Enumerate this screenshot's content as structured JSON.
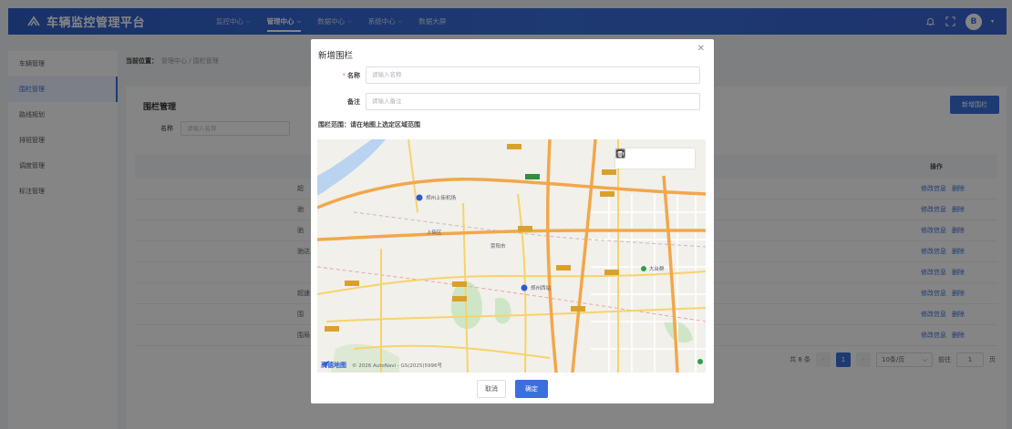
{
  "header": {
    "brand_title": "车辆监控管理平台",
    "nav": [
      {
        "label": "监控中心",
        "has_dropdown": true,
        "active": false
      },
      {
        "label": "管理中心",
        "has_dropdown": true,
        "active": true
      },
      {
        "label": "数据中心",
        "has_dropdown": true,
        "active": false
      },
      {
        "label": "系统中心",
        "has_dropdown": true,
        "active": false
      },
      {
        "label": "数据大屏",
        "has_dropdown": false,
        "active": false
      }
    ],
    "avatar_text": "B"
  },
  "sidebar": {
    "items": [
      {
        "label": "车辆管理",
        "active": false
      },
      {
        "label": "围栏管理",
        "active": true
      },
      {
        "label": "路线规划",
        "active": false
      },
      {
        "label": "排班管理",
        "active": false
      },
      {
        "label": "调度管理",
        "active": false
      },
      {
        "label": "标注管理",
        "active": false
      }
    ]
  },
  "breadcrumb": {
    "prefix": "当前位置：",
    "path": "管理中心 / 围栏管理"
  },
  "page": {
    "title": "围栏管理",
    "filter_label": "名称",
    "filter_placeholder": "请输入名称",
    "add_button": "新增围栏",
    "col_ops": "操作",
    "rows": [
      {
        "name": "超",
        "edit": "修改信息",
        "delete": "删除"
      },
      {
        "name": "驰",
        "edit": "修改信息",
        "delete": "删除"
      },
      {
        "name": "驰",
        "edit": "修改信息",
        "delete": "删除"
      },
      {
        "name": "驰达",
        "edit": "修改信息",
        "delete": "删除"
      },
      {
        "name": "",
        "edit": "修改信息",
        "delete": "删除"
      },
      {
        "name": "超速",
        "edit": "修改信息",
        "delete": "删除"
      },
      {
        "name": "围",
        "edit": "修改信息",
        "delete": "删除"
      },
      {
        "name": "围局",
        "edit": "修改信息",
        "delete": "删除"
      }
    ],
    "pagination": {
      "total": "共 8 条",
      "current": "1",
      "page_size": "10条/页",
      "goto_label": "前往",
      "goto_value": "1",
      "page_suffix": "页"
    }
  },
  "dialog": {
    "title": "新增围栏",
    "name_label": "名称",
    "name_placeholder": "请输入名称",
    "remark_label": "备注",
    "remark_placeholder": "请输入备注",
    "fence_hint": "围栏范围：请在地图上选定区域范围",
    "map": {
      "labels": {
        "airport": "郑州上街机场",
        "shangjie": "上街区",
        "xingyang": "荥阳市",
        "west_station": "郑州西站",
        "park": "大台群"
      },
      "road_shields": [
        "G310",
        "G234",
        "S314",
        "S312",
        "G107",
        "S232",
        "G310",
        "S314"
      ],
      "logo": "高德地图",
      "copyright": "© 2026 AutoNavi - GS(2025)5996号"
    },
    "draw_tools": [
      "trash-icon",
      "circle-tool-icon",
      "polygon-tool-icon",
      "rectangle-tool-icon"
    ],
    "cancel": "取消",
    "confirm": "确定"
  },
  "colors": {
    "primary": "#3b6fdc",
    "required": "#f56c6c"
  }
}
